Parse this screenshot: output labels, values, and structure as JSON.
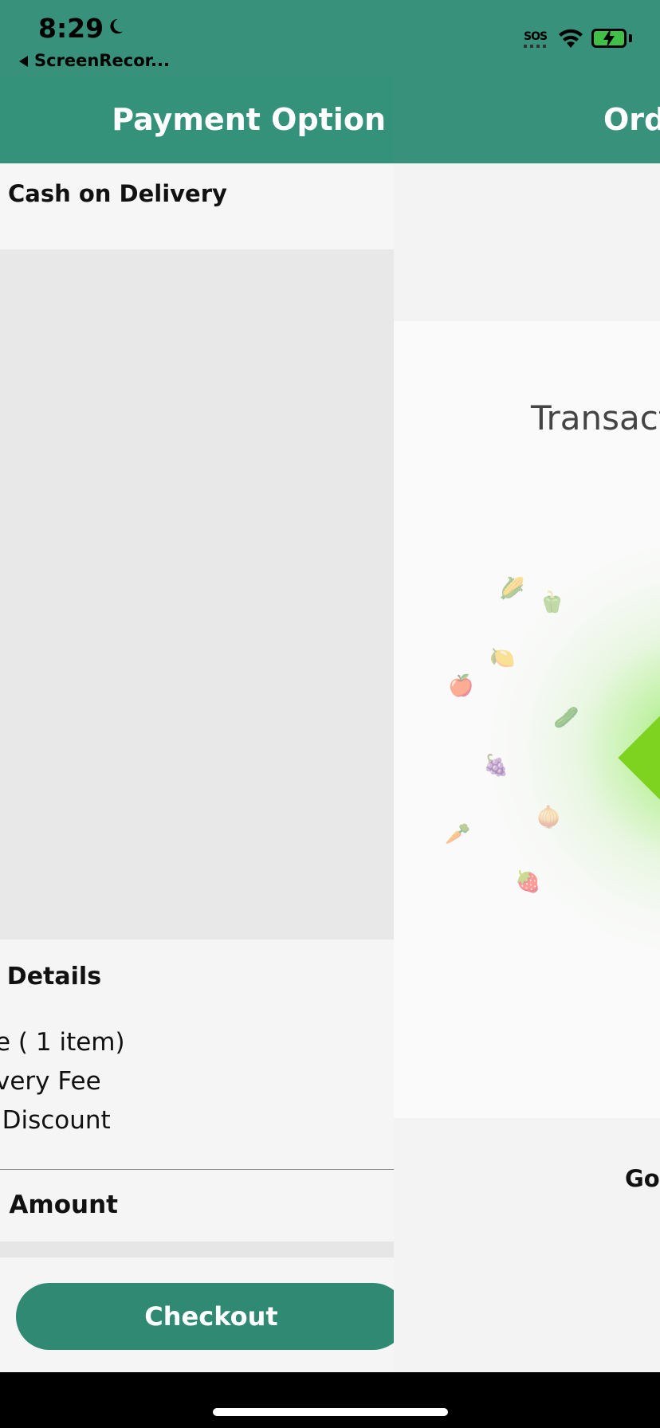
{
  "status_bar": {
    "time": "8:29",
    "back_app": "ScreenRecor...",
    "sos": "SOS"
  },
  "payment_screen": {
    "title": "Payment Option",
    "payment_method": "Cash on Delivery",
    "price_details_title": "e Details",
    "price_lines": [
      "e ( 1 item)",
      "very Fee",
      "lDiscount"
    ],
    "total_label": "l Amount",
    "checkout_label": "Checkout"
  },
  "order_screen": {
    "title": "Ord",
    "transaction_text": "Transact",
    "go_text": "Go"
  },
  "colors": {
    "header_green": "#37917b",
    "button_green": "#308a73",
    "accent_lime": "#7ed321"
  },
  "icons": [
    "moon-icon",
    "wifi-icon",
    "battery-icon",
    "back-triangle-icon",
    "grocery-icons"
  ]
}
